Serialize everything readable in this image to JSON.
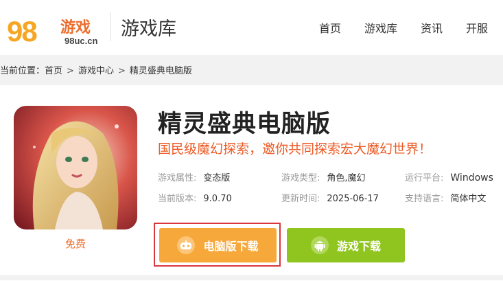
{
  "header": {
    "logo_number": "98",
    "logo_brand": "游戏",
    "logo_domain": "98uc.cn",
    "section_title": "游戏库",
    "nav": [
      "首页",
      "游戏库",
      "资讯",
      "开服"
    ]
  },
  "breadcrumb": {
    "prefix": "当前位置：",
    "items": [
      "首页",
      "游戏中心",
      "精灵盛典电脑版"
    ],
    "separator": ">"
  },
  "game": {
    "title": "精灵盛典电脑版",
    "slogan": "国民级魔幻探索，邀你共同探索宏大魔幻世界！",
    "price_label": "免费",
    "info": {
      "attr_label": "游戏属性:",
      "attr_value": "变态版",
      "type_label": "游戏类型:",
      "type_value": "角色,魔幻",
      "platform_label": "运行平台:",
      "platform_value": "Windows",
      "version_label": "当前版本:",
      "version_value": "9.0.70",
      "update_label": "更新时间:",
      "update_value": "2025-06-17",
      "lang_label": "支持语言:",
      "lang_value": "简体中文"
    },
    "buttons": {
      "pc_download": "电脑版下载",
      "game_download": "游戏下载"
    }
  },
  "colors": {
    "accent_orange": "#ec6d2c",
    "pc_button": "#f7a83a",
    "game_button": "#90c41f",
    "highlight_border": "#d9363e"
  },
  "icons": {
    "pc_button_icon": "gamepad-icon",
    "game_button_icon": "android-icon"
  }
}
